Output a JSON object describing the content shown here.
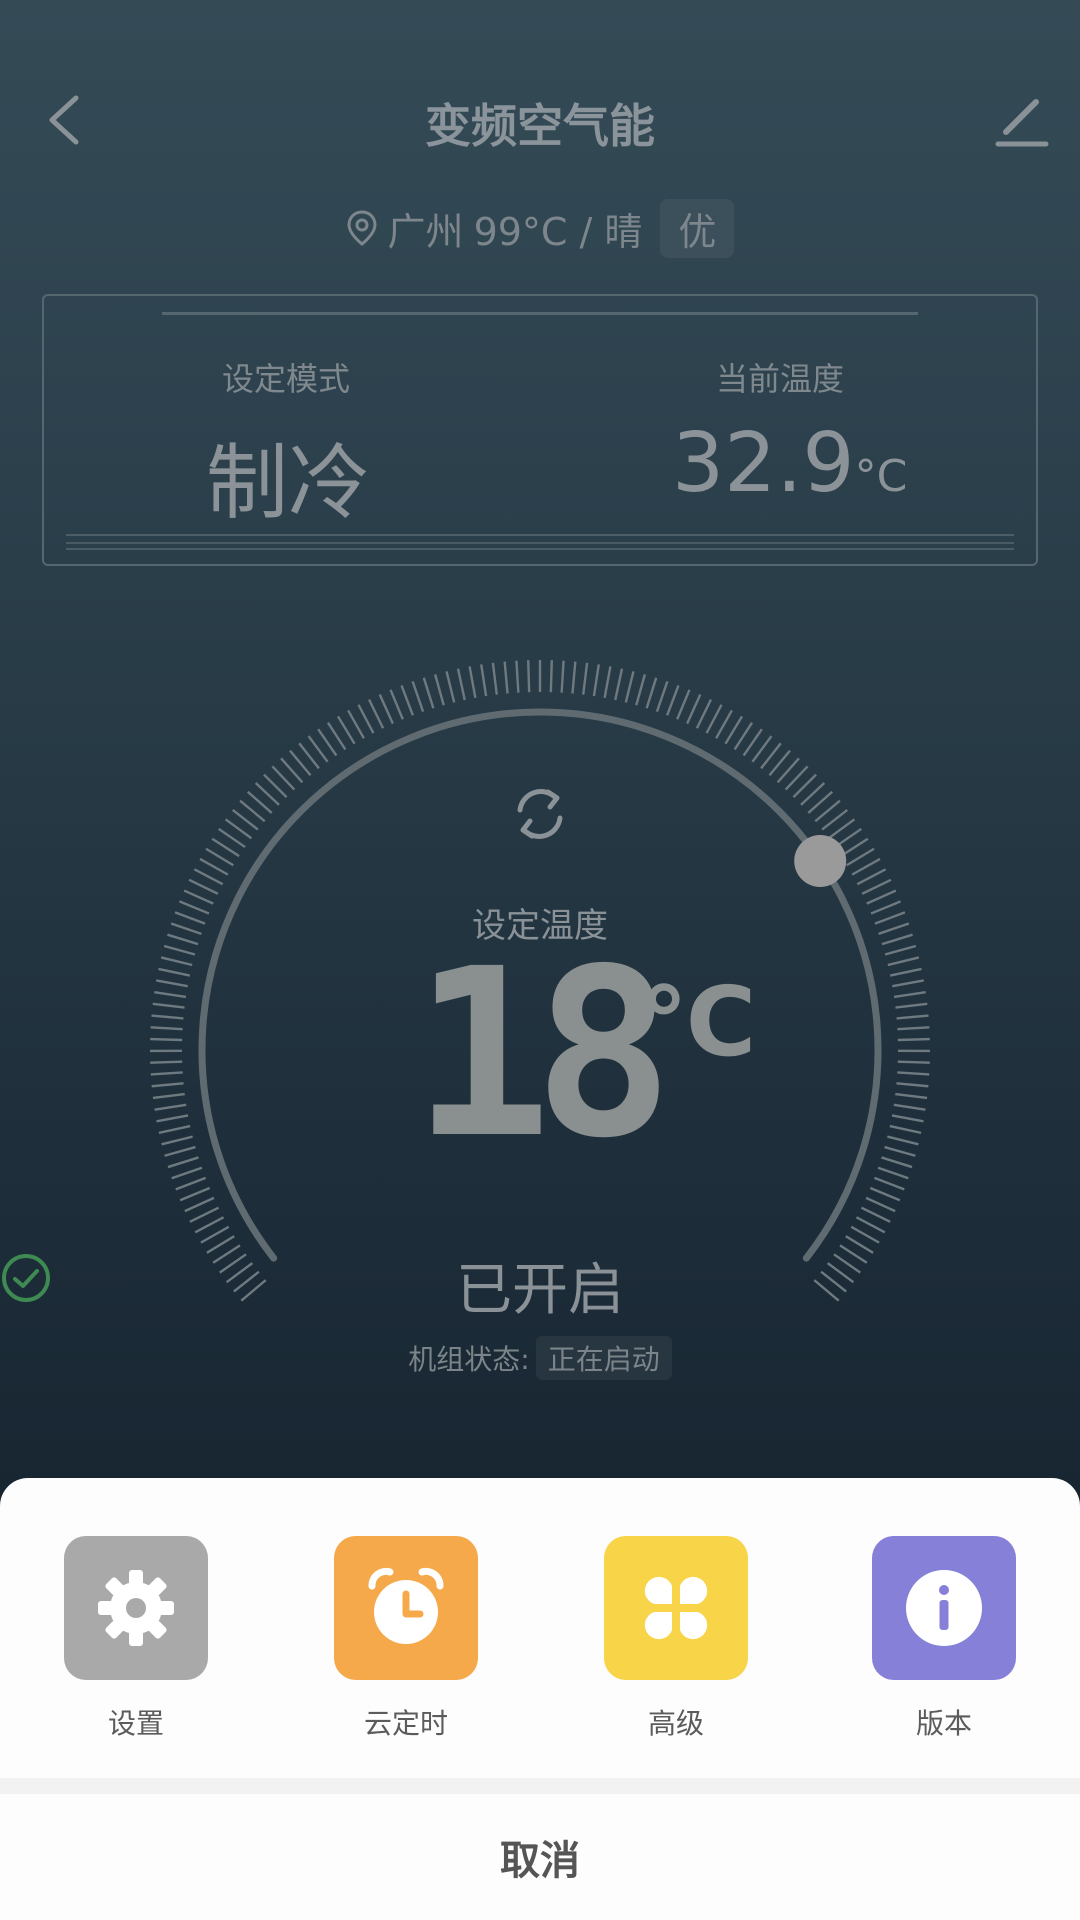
{
  "header": {
    "title": "变频空气能"
  },
  "weather": {
    "city": "广州",
    "temp_sky": "99°C / 晴",
    "aqi": "优"
  },
  "info_panel": {
    "mode_label": "设定模式",
    "mode_value": "制冷",
    "current_temp_label": "当前温度",
    "current_temp_value": "32.9",
    "current_temp_unit": "°C"
  },
  "dial": {
    "label": "设定温度",
    "value": "18",
    "unit": "℃",
    "power_status": "已开启",
    "unit_status_label": "机组状态:",
    "unit_status_value": "正在启动"
  },
  "sheet": {
    "items": [
      {
        "label": "设置",
        "color": "#a9a9a9",
        "icon": "gear-icon"
      },
      {
        "label": "云定时",
        "color": "#f5a94a",
        "icon": "alarm-clock-icon"
      },
      {
        "label": "高级",
        "color": "#f7d448",
        "icon": "clover-grid-icon"
      },
      {
        "label": "版本",
        "color": "#8780d8",
        "icon": "info-icon"
      }
    ],
    "cancel": "取消"
  }
}
